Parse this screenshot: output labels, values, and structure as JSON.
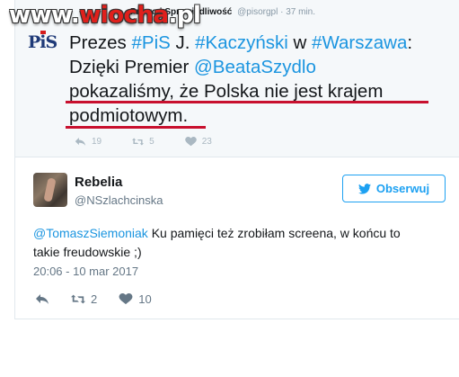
{
  "watermark": {
    "prefix": "www.",
    "brand": "wiocha",
    "suffix": ".pl"
  },
  "quoted_tweet": {
    "author_fragment": "Prawo i Sprawiedliwość",
    "handle": "@pisorgpl",
    "time": "37 min.",
    "logo_text": "PiS",
    "lines": [
      [
        {
          "t": "Prezes ",
          "link": false
        },
        {
          "t": "#PiS",
          "link": true
        },
        {
          "t": " J. ",
          "link": false
        },
        {
          "t": "#Kaczyński",
          "link": true
        },
        {
          "t": " w ",
          "link": false
        },
        {
          "t": "#Warszawa",
          "link": true
        },
        {
          "t": ":",
          "link": false
        }
      ],
      [
        {
          "t": "Dzięki Premier ",
          "link": false
        },
        {
          "t": "@BeataSzydlo",
          "link": true
        }
      ],
      [
        {
          "t": "pokazaliśmy, że Polska nie jest krajem",
          "link": false
        }
      ],
      [
        {
          "t": "podmiotowym.",
          "link": false
        }
      ]
    ],
    "reply_count": "19",
    "retweet_count": "5",
    "like_count": "23",
    "underline_color": "#c8102e"
  },
  "tweet": {
    "display_name": "Rebelia",
    "handle": "@NSzlachcinska",
    "follow_label": "Obserwuj",
    "mention": "@TomaszSiemoniak",
    "body_line1": " Ku pamięci też zrobiłam screena, w końcu to",
    "body_line2": "takie freudowskie ;)",
    "timestamp": "20:06 - 10 mar 2017",
    "retweet_count": "2",
    "like_count": "10"
  },
  "colors": {
    "link": "#1b95e0",
    "twitter_blue": "#1da1f2",
    "muted": "#657786"
  },
  "icons": [
    "reply-icon",
    "retweet-icon",
    "heart-icon",
    "twitter-bird-icon"
  ]
}
